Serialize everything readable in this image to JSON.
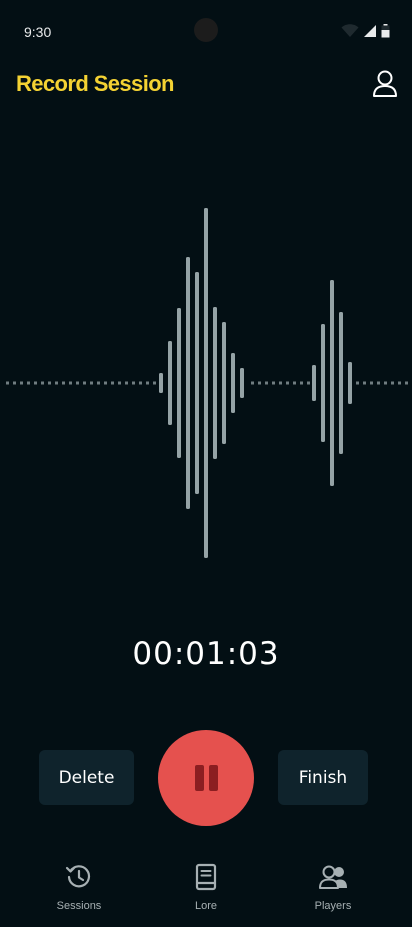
{
  "status_bar": {
    "time": "9:30"
  },
  "app_bar": {
    "title": "Record Session",
    "profile_icon": "person-icon"
  },
  "recording": {
    "elapsed": "00:01:03"
  },
  "controls": {
    "delete_label": "Delete",
    "pause_icon": "pause-icon",
    "finish_label": "Finish"
  },
  "bottom_nav": {
    "items": [
      {
        "label": "Sessions",
        "icon": "history-icon"
      },
      {
        "label": "Lore",
        "icon": "book-icon"
      },
      {
        "label": "Players",
        "icon": "people-icon"
      }
    ]
  },
  "colors": {
    "background": "#030f14",
    "title": "#f4d233",
    "record_button": "#e5514e",
    "secondary_button": "#0f232c",
    "waveform": "#95a3a6"
  }
}
